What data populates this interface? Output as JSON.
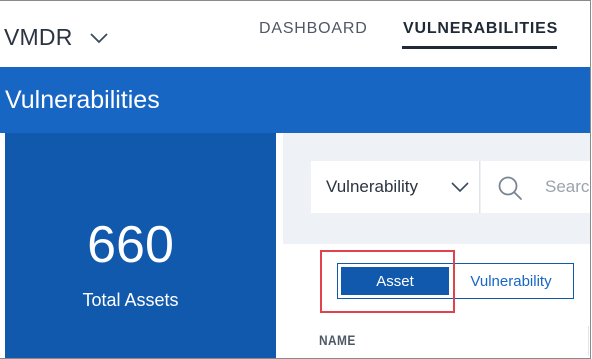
{
  "topnav": {
    "app_name": "VMDR",
    "tabs": [
      {
        "label": "DASHBOARD",
        "active": false
      },
      {
        "label": "VULNERABILITIES",
        "active": true
      }
    ]
  },
  "header": {
    "title": "Vulnerabilities"
  },
  "summary": {
    "count": "660",
    "label": "Total Assets"
  },
  "filters": {
    "search_type": "Vulnerability",
    "search_placeholder": "Search"
  },
  "view_toggle": {
    "options": [
      {
        "label": "Asset",
        "active": true
      },
      {
        "label": "Vulnerability",
        "active": false
      }
    ]
  },
  "table": {
    "columns": [
      "NAME"
    ]
  },
  "colors": {
    "brand_blue": "#1866c4",
    "card_blue": "#1159ad",
    "highlight_red": "#e0434e"
  }
}
